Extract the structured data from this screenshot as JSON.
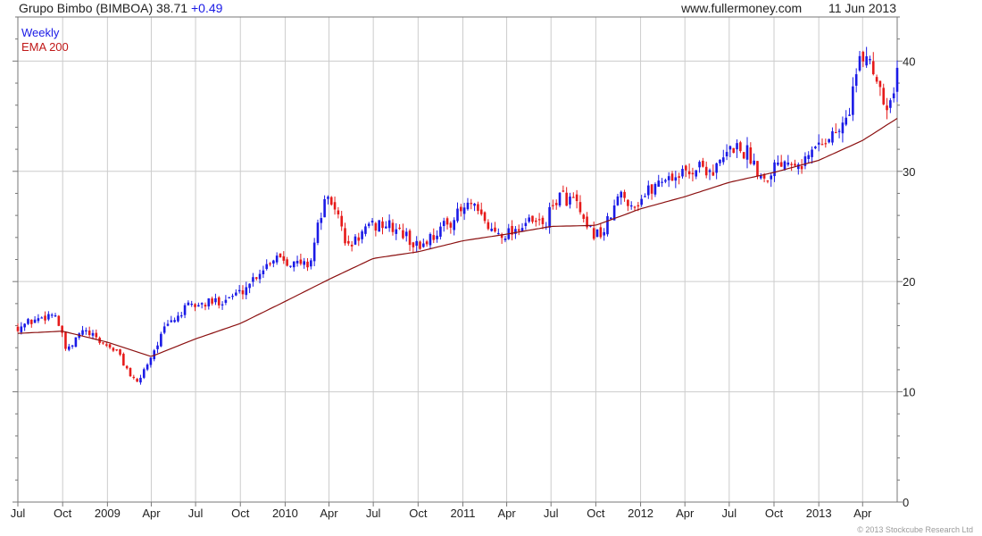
{
  "header": {
    "ticker": "Grupo Bimbo (BIMBOA)",
    "last": "38.71",
    "change": "+0.49",
    "source": "www.fullermoney.com",
    "date": "11 Jun 2013"
  },
  "legend": {
    "series1": "Weekly",
    "series2": "EMA 200"
  },
  "copyright": "© 2013 Stockcube Research Ltd",
  "colors": {
    "up": "#1a1ae6",
    "down": "#e61a1a",
    "ema": "#8b1010",
    "grid": "#cccccc",
    "frame": "#777777"
  },
  "chart_data": {
    "type": "candlestick",
    "frequency": "weekly",
    "y_axis": {
      "range": [
        0,
        44
      ],
      "ticks": [
        0,
        10,
        20,
        30,
        40
      ],
      "side": "right"
    },
    "x_axis": {
      "labels": [
        "Jul",
        "Oct",
        "2009",
        "Apr",
        "Jul",
        "Oct",
        "2010",
        "Apr",
        "Jul",
        "Oct",
        "2011",
        "Apr",
        "Jul",
        "Oct",
        "2012",
        "Apr",
        "Jul",
        "Oct",
        "2013",
        "Apr"
      ],
      "label_dates": [
        "2008-07-01",
        "2008-10-01",
        "2009-01-01",
        "2009-04-01",
        "2009-07-01",
        "2009-10-01",
        "2010-01-01",
        "2010-04-01",
        "2010-07-01",
        "2010-10-01",
        "2011-01-01",
        "2011-04-01",
        "2011-07-01",
        "2011-10-01",
        "2012-01-01",
        "2012-04-01",
        "2012-07-01",
        "2012-10-01",
        "2013-01-01",
        "2013-04-01"
      ],
      "range": [
        "2008-07-01",
        "2013-06-11"
      ]
    },
    "grid": true,
    "price_anchors": [
      [
        "2008-07-01",
        15.9
      ],
      [
        "2008-08-15",
        16.7
      ],
      [
        "2008-09-15",
        17.2
      ],
      [
        "2008-10-10",
        13.5
      ],
      [
        "2008-11-10",
        15.6
      ],
      [
        "2008-12-15",
        14.6
      ],
      [
        "2009-01-20",
        13.7
      ],
      [
        "2009-03-01",
        10.6
      ],
      [
        "2009-04-01",
        13.3
      ],
      [
        "2009-05-01",
        15.9
      ],
      [
        "2009-06-15",
        17.7
      ],
      [
        "2009-08-15",
        18.2
      ],
      [
        "2009-10-01",
        19.0
      ],
      [
        "2009-11-15",
        21.2
      ],
      [
        "2009-12-15",
        22.5
      ],
      [
        "2010-01-20",
        21.6
      ],
      [
        "2010-02-20",
        21.6
      ],
      [
        "2010-03-20",
        27.0
      ],
      [
        "2010-04-10",
        27.2
      ],
      [
        "2010-05-10",
        23.0
      ],
      [
        "2010-06-10",
        24.5
      ],
      [
        "2010-07-15",
        25.3
      ],
      [
        "2010-08-20",
        24.7
      ],
      [
        "2010-10-01",
        23.1
      ],
      [
        "2010-12-01",
        25.3
      ],
      [
        "2011-01-15",
        27.0
      ],
      [
        "2011-03-01",
        24.6
      ],
      [
        "2011-04-01",
        24.4
      ],
      [
        "2011-05-10",
        25.3
      ],
      [
        "2011-06-20",
        25.3
      ],
      [
        "2011-07-15",
        27.8
      ],
      [
        "2011-08-20",
        27.3
      ],
      [
        "2011-09-10",
        24.6
      ],
      [
        "2011-10-15",
        24.3
      ],
      [
        "2011-11-20",
        27.9
      ],
      [
        "2011-12-20",
        27.0
      ],
      [
        "2012-01-20",
        28.3
      ],
      [
        "2012-02-15",
        29.4
      ],
      [
        "2012-04-01",
        29.8
      ],
      [
        "2012-05-01",
        30.5
      ],
      [
        "2012-06-01",
        30.0
      ],
      [
        "2012-07-10",
        32.3
      ],
      [
        "2012-08-10",
        31.6
      ],
      [
        "2012-09-10",
        29.3
      ],
      [
        "2012-10-10",
        31.0
      ],
      [
        "2012-11-10",
        31.3
      ],
      [
        "2012-12-01",
        30.8
      ],
      [
        "2013-01-01",
        32.6
      ],
      [
        "2013-02-01",
        33.4
      ],
      [
        "2013-02-25",
        34.3
      ],
      [
        "2013-03-20",
        39.0
      ],
      [
        "2013-04-10",
        40.8
      ],
      [
        "2013-05-01",
        38.4
      ],
      [
        "2013-05-25",
        35.8
      ],
      [
        "2013-06-11",
        38.7
      ]
    ],
    "ema_anchors": [
      [
        "2008-07-01",
        15.3
      ],
      [
        "2008-10-01",
        15.5
      ],
      [
        "2009-01-01",
        14.5
      ],
      [
        "2009-04-01",
        13.2
      ],
      [
        "2009-07-01",
        14.8
      ],
      [
        "2009-10-01",
        16.2
      ],
      [
        "2010-01-01",
        18.2
      ],
      [
        "2010-04-01",
        20.2
      ],
      [
        "2010-07-01",
        22.1
      ],
      [
        "2010-10-01",
        22.7
      ],
      [
        "2011-01-01",
        23.7
      ],
      [
        "2011-04-01",
        24.3
      ],
      [
        "2011-07-01",
        25.0
      ],
      [
        "2011-10-01",
        25.1
      ],
      [
        "2012-01-01",
        26.6
      ],
      [
        "2012-04-01",
        27.7
      ],
      [
        "2012-07-01",
        29.0
      ],
      [
        "2012-10-01",
        29.9
      ],
      [
        "2013-01-01",
        31.0
      ],
      [
        "2013-04-01",
        32.8
      ],
      [
        "2013-06-11",
        34.8
      ]
    ]
  }
}
